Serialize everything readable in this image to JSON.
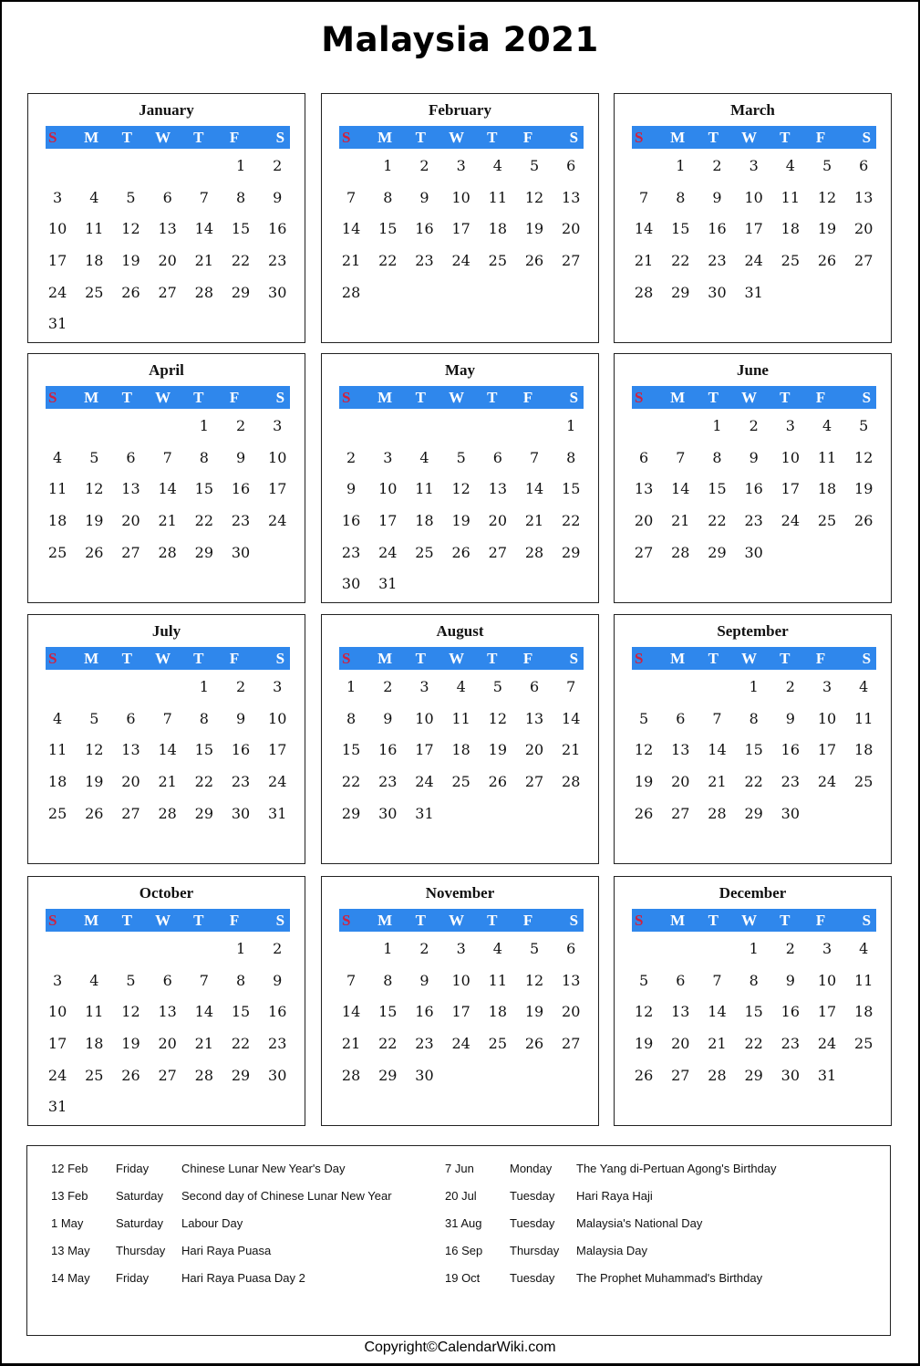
{
  "title": "Malaysia 2021",
  "weekdays": [
    "S",
    "M",
    "T",
    "W",
    "T",
    "F",
    "S"
  ],
  "colors": {
    "header_bar": "#2f87ec",
    "sunday": "#d0213e",
    "weekday_text": "#ffffff"
  },
  "months": [
    {
      "name": "January",
      "start": 5,
      "days": 31
    },
    {
      "name": "February",
      "start": 1,
      "days": 28
    },
    {
      "name": "March",
      "start": 1,
      "days": 31
    },
    {
      "name": "April",
      "start": 4,
      "days": 30
    },
    {
      "name": "May",
      "start": 6,
      "days": 31
    },
    {
      "name": "June",
      "start": 2,
      "days": 30
    },
    {
      "name": "July",
      "start": 4,
      "days": 31
    },
    {
      "name": "August",
      "start": 0,
      "days": 31
    },
    {
      "name": "September",
      "start": 3,
      "days": 30
    },
    {
      "name": "October",
      "start": 5,
      "days": 31
    },
    {
      "name": "November",
      "start": 1,
      "days": 30
    },
    {
      "name": "December",
      "start": 3,
      "days": 31
    }
  ],
  "holidays": {
    "left": [
      {
        "date": "12 Feb",
        "day": "Friday",
        "name": "Chinese Lunar New Year's Day"
      },
      {
        "date": "13 Feb",
        "day": "Saturday",
        "name": "Second day of Chinese Lunar New Year"
      },
      {
        "date": "1 May",
        "day": "Saturday",
        "name": "Labour Day"
      },
      {
        "date": "13 May",
        "day": "Thursday",
        "name": "Hari Raya Puasa"
      },
      {
        "date": "14 May",
        "day": "Friday",
        "name": "Hari Raya Puasa Day 2"
      }
    ],
    "right": [
      {
        "date": "7 Jun",
        "day": "Monday",
        "name": "The Yang di-Pertuan Agong's Birthday"
      },
      {
        "date": "20 Jul",
        "day": "Tuesday",
        "name": "Hari Raya Haji"
      },
      {
        "date": "31 Aug",
        "day": "Tuesday",
        "name": "Malaysia's National Day"
      },
      {
        "date": "16 Sep",
        "day": "Thursday",
        "name": "Malaysia Day"
      },
      {
        "date": "19 Oct",
        "day": "Tuesday",
        "name": "The Prophet Muhammad's Birthday"
      }
    ]
  },
  "copyright": "Copyright©CalendarWiki.com"
}
